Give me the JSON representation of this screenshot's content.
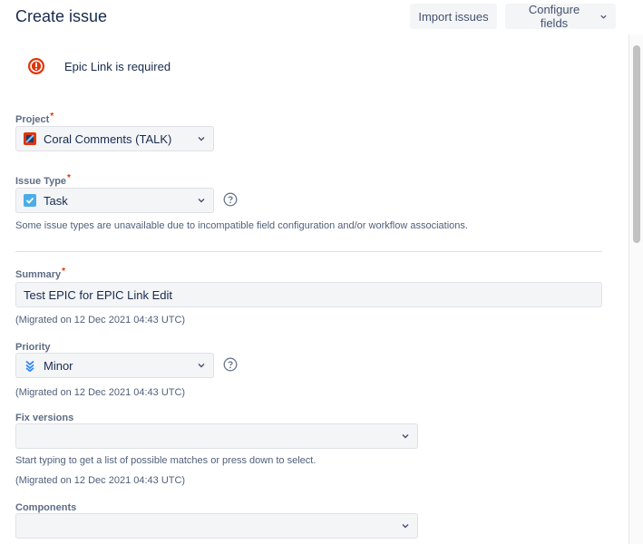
{
  "dialog": {
    "title": "Create issue",
    "import_label": "Import issues",
    "configure_label": "Configure fields"
  },
  "error": {
    "message": "Epic Link is required"
  },
  "fields": {
    "project": {
      "label": "Project",
      "required_mark": "*",
      "value": "Coral Comments (TALK)"
    },
    "issue_type": {
      "label": "Issue Type",
      "required_mark": "*",
      "value": "Task",
      "note": "Some issue types are unavailable due to incompatible field configuration and/or workflow associations."
    },
    "summary": {
      "label": "Summary",
      "required_mark": "*",
      "value": "Test EPIC for EPIC Link Edit",
      "note": "(Migrated on 12 Dec 2021 04:43 UTC)"
    },
    "priority": {
      "label": "Priority",
      "value": "Minor",
      "note": "(Migrated on 12 Dec 2021 04:43 UTC)"
    },
    "fix_versions": {
      "label": "Fix versions",
      "value": "",
      "hint": "Start typing to get a list of possible matches or press down to select.",
      "note": "(Migrated on 12 Dec 2021 04:43 UTC)"
    },
    "components": {
      "label": "Components",
      "value": ""
    }
  },
  "icons": {
    "error": "error-icon",
    "project": "project-avatar-icon",
    "task": "task-checkbox-icon",
    "priority_minor": "priority-minor-icon",
    "help": "help-icon",
    "chevron": "chevron-down-icon"
  },
  "colors": {
    "error_red": "#de350b",
    "task_blue": "#4bade8",
    "minor_blue": "#2684ff",
    "field_bg": "#f4f5f7"
  }
}
